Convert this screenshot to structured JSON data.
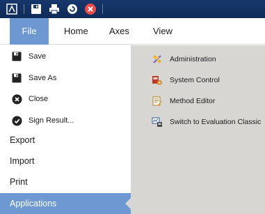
{
  "quick_access": {
    "icons": [
      "app-logo-icon",
      "save-icon",
      "print-icon",
      "refresh-icon",
      "close-icon"
    ]
  },
  "ribbon": {
    "tabs": [
      {
        "id": "file",
        "label": "File"
      },
      {
        "id": "home",
        "label": "Home"
      },
      {
        "id": "axes",
        "label": "Axes"
      },
      {
        "id": "view",
        "label": "View"
      }
    ],
    "active_tab": "File"
  },
  "file_menu": {
    "commands": [
      {
        "label": "Save",
        "icon": "save-icon"
      },
      {
        "label": "Save As",
        "icon": "save-as-icon"
      },
      {
        "label": "Close",
        "icon": "close-circle-icon"
      },
      {
        "label": "Sign Result...",
        "icon": "check-circle-icon"
      }
    ],
    "sections": [
      {
        "label": "Export"
      },
      {
        "label": "Import"
      },
      {
        "label": "Print"
      },
      {
        "label": "Applications",
        "selected": true
      }
    ]
  },
  "applications": {
    "items": [
      {
        "label": "Administration",
        "icon": "administration-icon"
      },
      {
        "label": "System Control",
        "icon": "system-control-icon"
      },
      {
        "label": "Method Editor",
        "icon": "method-editor-icon"
      },
      {
        "label": "Switch to Evaluation Classic",
        "icon": "switch-evaluation-icon"
      }
    ]
  },
  "colors": {
    "titlebar": "#17376b",
    "accent": "#6d98d2",
    "pane": "#d6d6d6"
  }
}
